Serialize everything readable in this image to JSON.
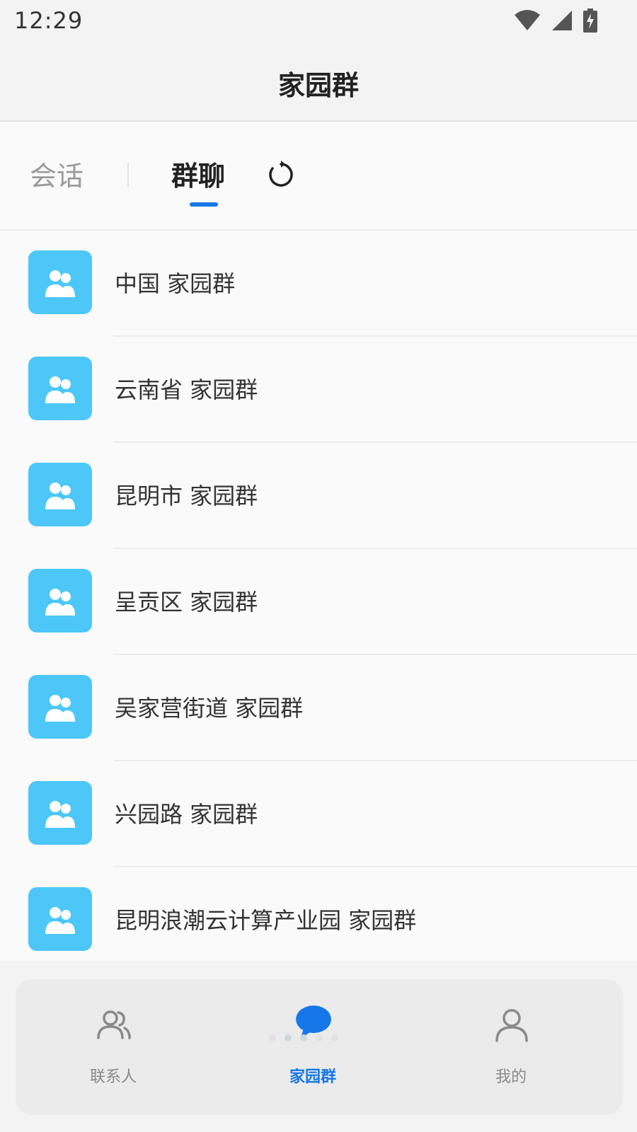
{
  "status_bar": {
    "time": "12:29"
  },
  "header": {
    "title": "家园群"
  },
  "tabs": [
    {
      "label": "会话",
      "active": false
    },
    {
      "label": "群聊",
      "active": true
    }
  ],
  "groups": [
    {
      "name": "中国 家园群"
    },
    {
      "name": "云南省 家园群"
    },
    {
      "name": "昆明市 家园群"
    },
    {
      "name": "呈贡区 家园群"
    },
    {
      "name": "吴家营街道 家园群"
    },
    {
      "name": "兴园路 家园群"
    },
    {
      "name": "昆明浪潮云计算产业园 家园群"
    }
  ],
  "bottom_nav": [
    {
      "label": "联系人",
      "icon": "contacts-icon",
      "active": false
    },
    {
      "label": "家园群",
      "icon": "chat-bubble-icon",
      "active": true
    },
    {
      "label": "我的",
      "icon": "person-icon",
      "active": false
    }
  ],
  "colors": {
    "accent": "#1677e8",
    "avatar_bg": "#4cc7f8"
  }
}
